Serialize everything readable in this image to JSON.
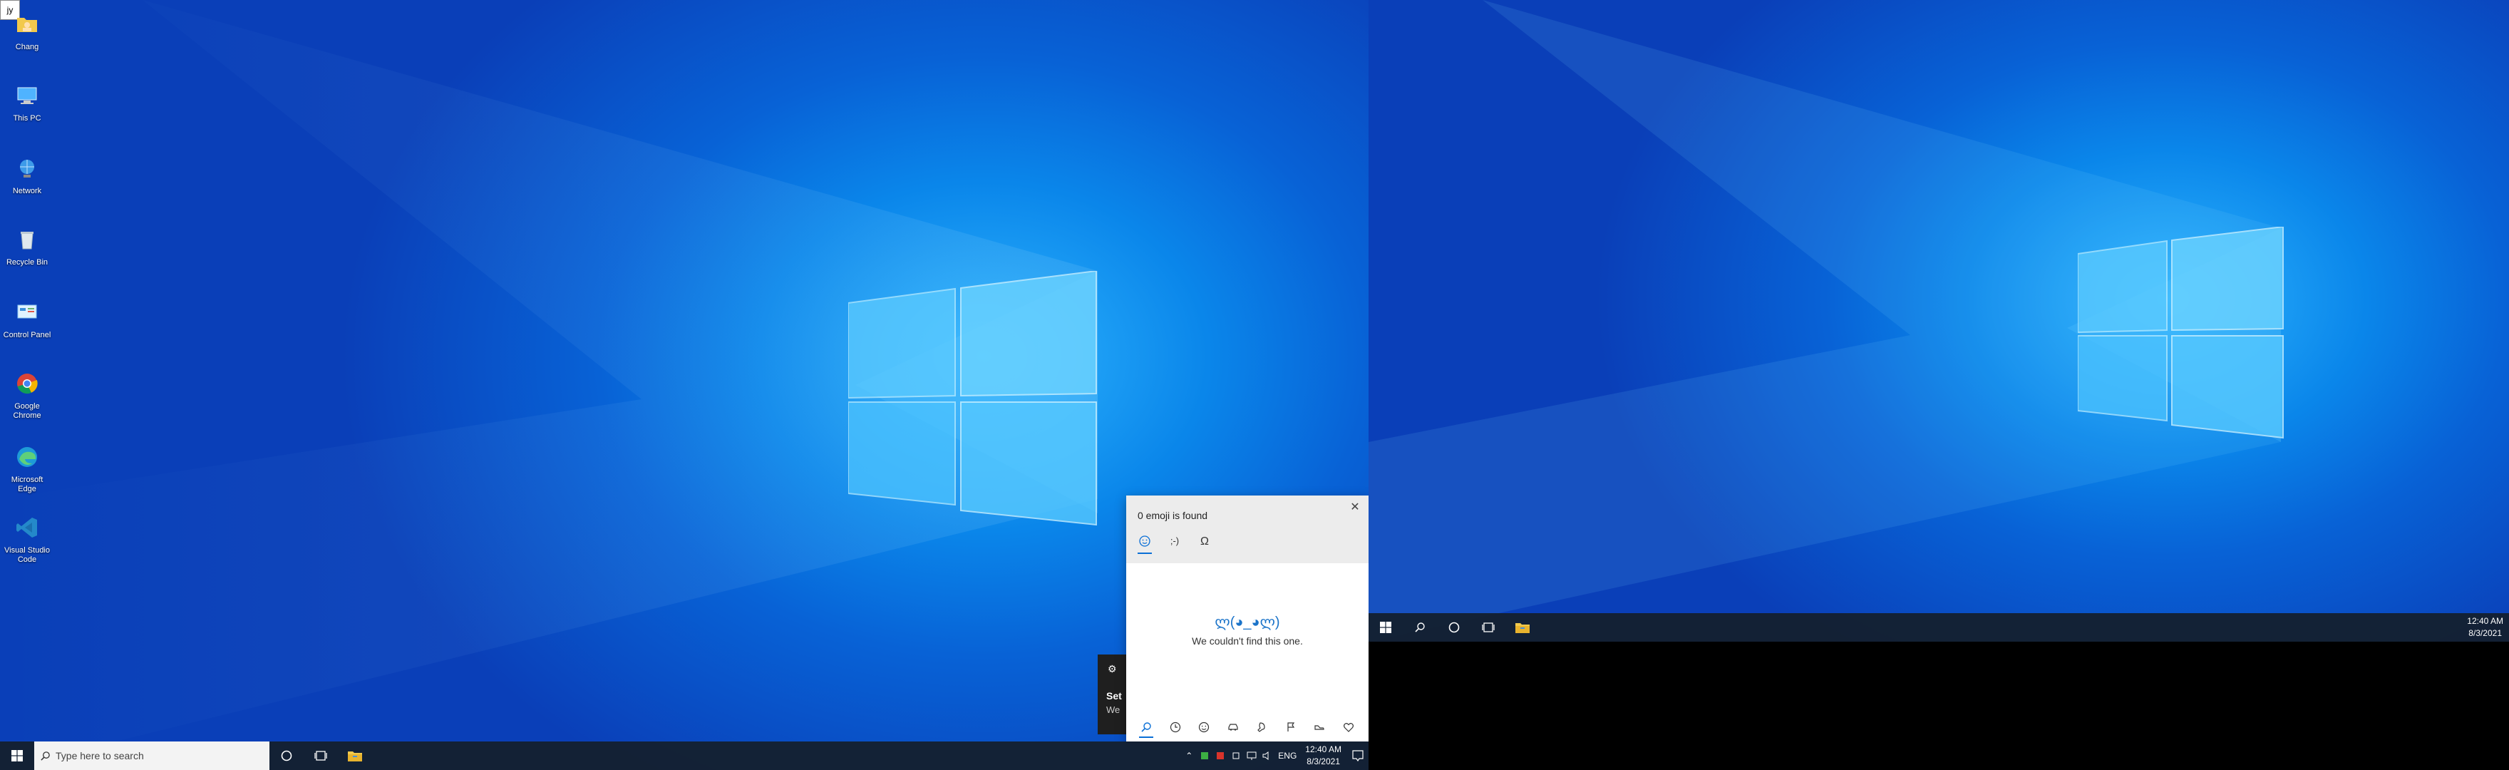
{
  "left": {
    "desktop_icons": [
      {
        "label": "Chang",
        "icon": "user-folder-icon"
      },
      {
        "label": "This PC",
        "icon": "this-pc-icon"
      },
      {
        "label": "Network",
        "icon": "network-icon"
      },
      {
        "label": "Recycle Bin",
        "icon": "recycle-bin-icon"
      },
      {
        "label": "Control Panel",
        "icon": "control-panel-icon"
      },
      {
        "label": "Google Chrome",
        "icon": "chrome-icon"
      },
      {
        "label": "Microsoft Edge",
        "icon": "edge-icon"
      },
      {
        "label": "Visual Studio Code",
        "icon": "vscode-icon"
      }
    ],
    "top_left_app_label": "jy",
    "taskbar": {
      "search_placeholder": "Type here to search",
      "language": "ENG",
      "time": "12:40 AM",
      "date": "8/3/2021"
    }
  },
  "emoji_panel": {
    "title": "0 emoji is found",
    "close_glyph": "✕",
    "kaomoji": "ლ(◕_◕ლ)",
    "message": "We couldn't find this one."
  },
  "toast": {
    "title_fragment": "Set",
    "body_fragment": "We"
  },
  "right": {
    "taskbar": {
      "time": "12:40 AM",
      "date": "8/3/2021"
    }
  },
  "colors": {
    "accent": "#0a6fd6",
    "taskbar": "#142030",
    "emoji_header": "#ececec"
  }
}
